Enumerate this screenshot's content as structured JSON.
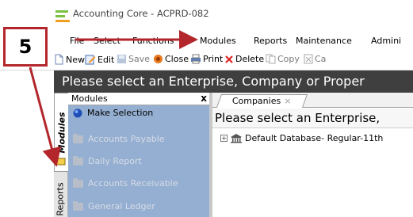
{
  "window": {
    "title": "Accounting Core - ACPRD-082"
  },
  "menubar": {
    "items": [
      "File",
      "Select",
      "Functions",
      "Modules",
      "Reports",
      "Maintenance",
      "Admini"
    ]
  },
  "toolbar": {
    "new_label": "New",
    "edit_label": "Edit",
    "save_label": "Save",
    "close_label": "Close",
    "print_label": "Print",
    "delete_label": "Delete",
    "copy_label": "Copy",
    "ca_label": "Ca"
  },
  "header": {
    "prompt": "Please select an Enterprise, Company or Proper"
  },
  "side_tabs": {
    "modules": "Modules",
    "reports": "Reports"
  },
  "modules_panel": {
    "title": "Modules",
    "close_glyph": "x",
    "items": [
      {
        "label": "Make Selection",
        "enabled": true,
        "icon": "globe-icon"
      },
      {
        "label": "Accounts Payable",
        "enabled": false,
        "icon": "folder-icon"
      },
      {
        "label": "Daily Report",
        "enabled": false,
        "icon": "folder-icon"
      },
      {
        "label": "Accounts Receivable",
        "enabled": false,
        "icon": "folder-icon"
      },
      {
        "label": "General Ledger",
        "enabled": false,
        "icon": "folder-icon"
      }
    ]
  },
  "content": {
    "tab_label": "Companies",
    "tab_close": "×",
    "instruction": "Please select an Enterprise,",
    "tree_root": "Default Database- Regular-11th",
    "expander": "+"
  },
  "annotation": {
    "step_number": "5",
    "color": "#b3262b"
  },
  "colors": {
    "panel_bg": "#94afd1",
    "header_bg": "#3f3f3f",
    "annotation_red": "#b3262b"
  }
}
